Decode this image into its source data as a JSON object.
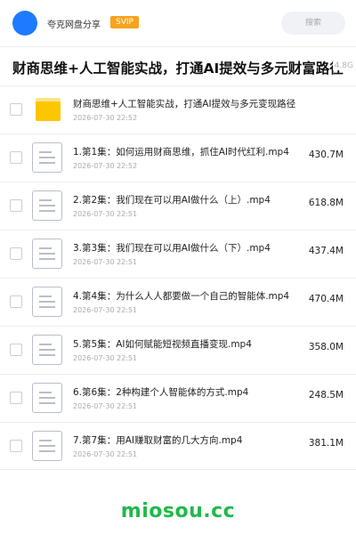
{
  "header": {
    "brand": "夸克网盘分享",
    "badge": "SVIP",
    "search_placeholder": "搜索"
  },
  "share": {
    "title": "财商思维+人工智能实战，打通AI提效与多元财富路径",
    "total_size": "4.8G"
  },
  "files": [
    {
      "type": "folder",
      "name": "财商思维+人工智能实战，打通AI提效与多元变现路径",
      "date": "2026-07-30 22:52",
      "size": ""
    },
    {
      "type": "file",
      "name": "1.第1集：如何运用财商思维，抓住AI时代红利.mp4",
      "date": "2026-07-30 22:52",
      "size": "430.7M"
    },
    {
      "type": "file",
      "name": "2.第2集：我们现在可以用AI做什么（上）.mp4",
      "date": "2026-07-30 22:51",
      "size": "618.8M"
    },
    {
      "type": "file",
      "name": "3.第3集：我们现在可以用AI做什么（下）.mp4",
      "date": "2026-07-30 22:51",
      "size": "437.4M"
    },
    {
      "type": "file",
      "name": "4.第4集：为什么人人都要做一个自己的智能体.mp4",
      "date": "2026-07-30 22:51",
      "size": "470.4M"
    },
    {
      "type": "file",
      "name": "5.第5集：AI如何赋能短视频直播变现.mp4",
      "date": "2026-07-30 22:51",
      "size": "358.0M"
    },
    {
      "type": "file",
      "name": "6.第6集：2种构建个人智能体的方式.mp4",
      "date": "2026-07-30 22:51",
      "size": "248.5M"
    },
    {
      "type": "file",
      "name": "7.第7集：用AI赚取财富的几大方向.mp4",
      "date": "2026-07-30 22:51",
      "size": "381.1M"
    }
  ],
  "watermark": "miosou.cc",
  "colors": {
    "accent": "#1e7bff",
    "svip": "#f7a31c",
    "folder": "#fdc700",
    "watermark": "#20b94a"
  }
}
